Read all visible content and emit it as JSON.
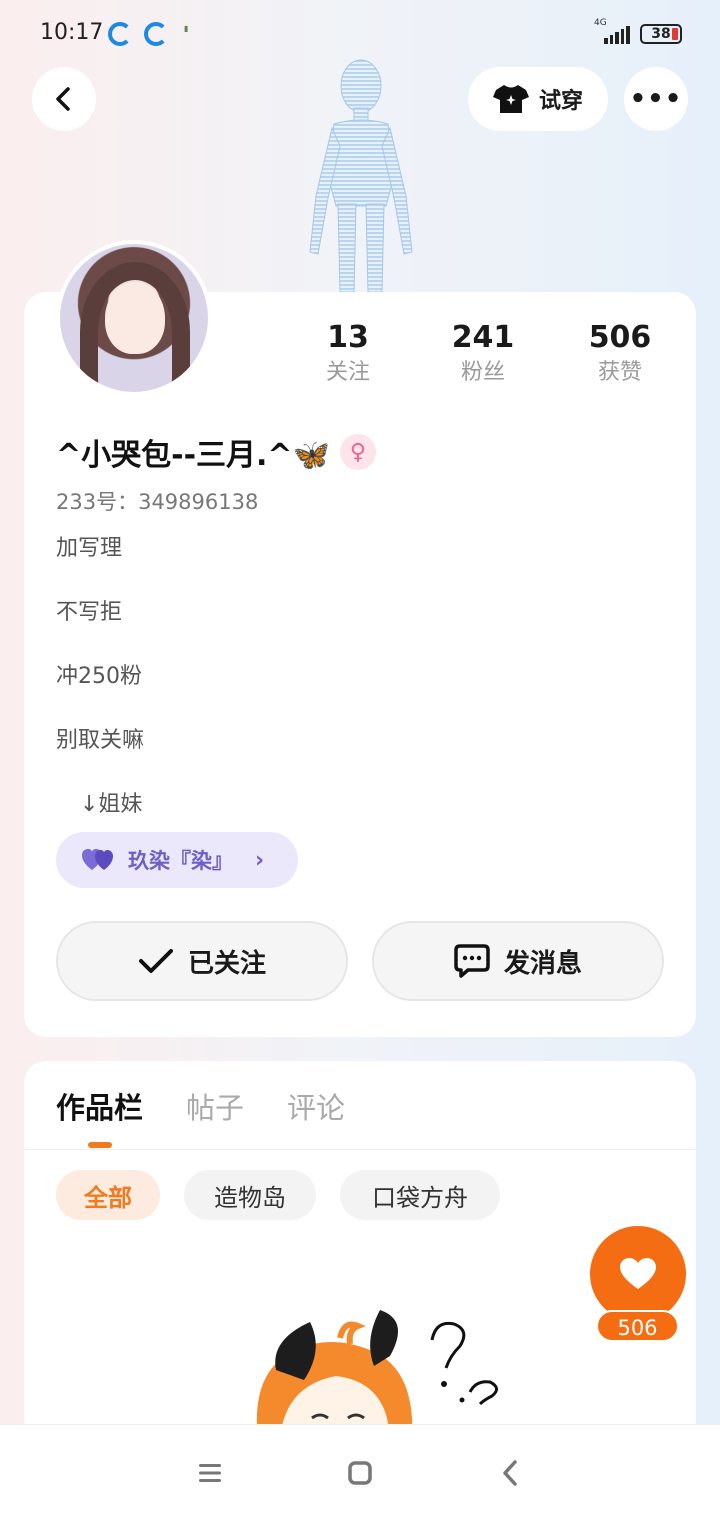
{
  "status_bar": {
    "time": "10:17",
    "network": "4G",
    "battery": "38"
  },
  "header": {
    "back_icon": "chevron-left-icon",
    "try_on_label": "试穿",
    "more_label": "•••"
  },
  "profile": {
    "username": "^小哭包--三月.^🦋",
    "gender_symbol": "♀",
    "uid": "233号：349896138",
    "stats": [
      {
        "value": "13",
        "label": "关注"
      },
      {
        "value": "241",
        "label": "粉丝"
      },
      {
        "value": "506",
        "label": "获赞"
      }
    ],
    "bio": [
      "加写理",
      "不写拒",
      "冲250粉",
      "别取关嘛",
      "↓姐妹"
    ],
    "fan_tag": "玖染『染』",
    "followed_label": "已关注",
    "message_label": "发消息"
  },
  "works": {
    "tabs": [
      "作品栏",
      "帖子",
      "评论"
    ],
    "filters": [
      "全部",
      "造物岛",
      "口袋方舟"
    ],
    "like_count": "506"
  },
  "colors": {
    "accent": "#f56d12",
    "fan_tag": "#6c5fc7"
  }
}
